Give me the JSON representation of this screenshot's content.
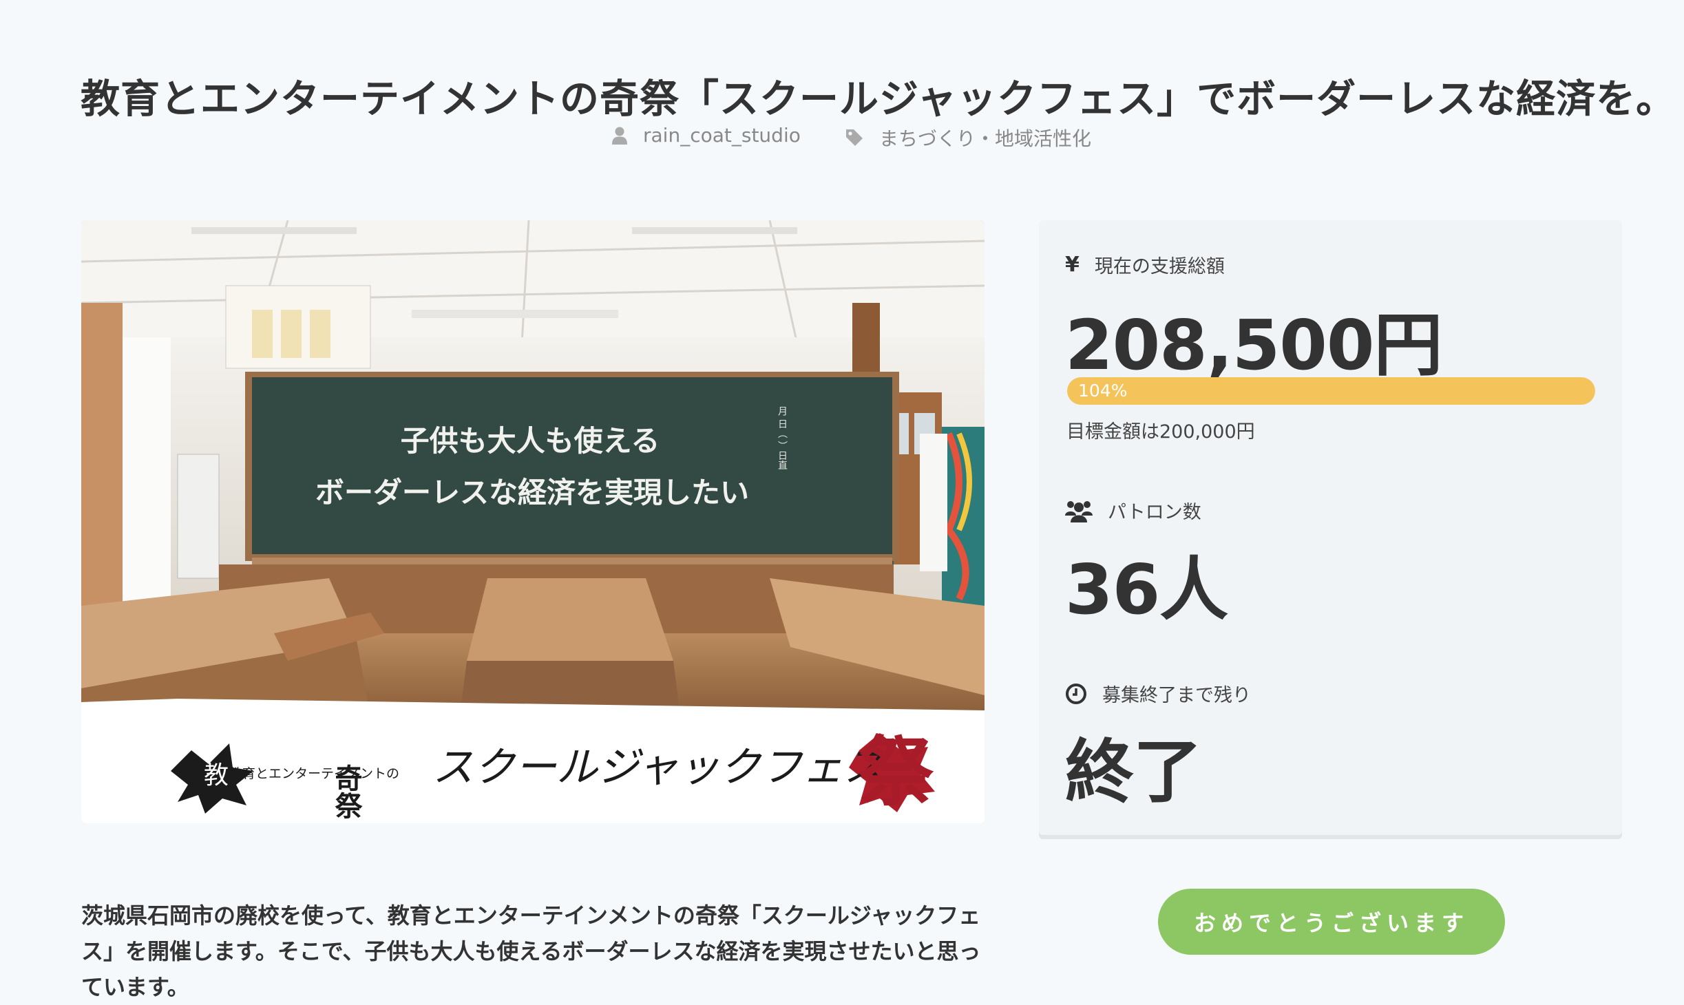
{
  "project": {
    "title": "教育とエンターテイメントの奇祭「スクールジャックフェス」でボーダーレスな経済を。",
    "author": "rain_coat_studio",
    "category": "まちづくり・地域活性化"
  },
  "hero": {
    "chalkboard_line1": "子供も大人も使える",
    "chalkboard_line2": "ボーダーレスな経済を実現したい",
    "board_date": "月 日（ ）日直",
    "banner_small": "教育とエンターテイメントの",
    "banner_kisai": "奇祭",
    "banner_main": "スクールジャックフェス",
    "banner_matsuri": "祭"
  },
  "stats": {
    "funding_label": "現在の支援総額",
    "funding_amount": "208,500円",
    "progress_percent": 104,
    "progress_label": "104%",
    "goal_text": "目標金額は200,000円",
    "patrons_label": "パトロン数",
    "patrons_count": "36人",
    "remaining_label": "募集終了まで残り",
    "remaining_value": "終了"
  },
  "description": "茨城県石岡市の廃校を使って、教育とエンターテインメントの奇祭「スクールジャックフェス」を開催します。そこで、子供も大人も使えるボーダーレスな経済を実現させたいと思っています。",
  "cta_label": "おめでとうございます",
  "icons": {
    "author": "user-icon",
    "category": "tag-icon",
    "funding": "yen-icon",
    "patrons": "users-icon",
    "remaining": "clock-icon"
  },
  "colors": {
    "progress": "#f4c45a",
    "cta": "#8cc763",
    "background": "#f6f9fc",
    "panel": "#f1f4f7"
  }
}
